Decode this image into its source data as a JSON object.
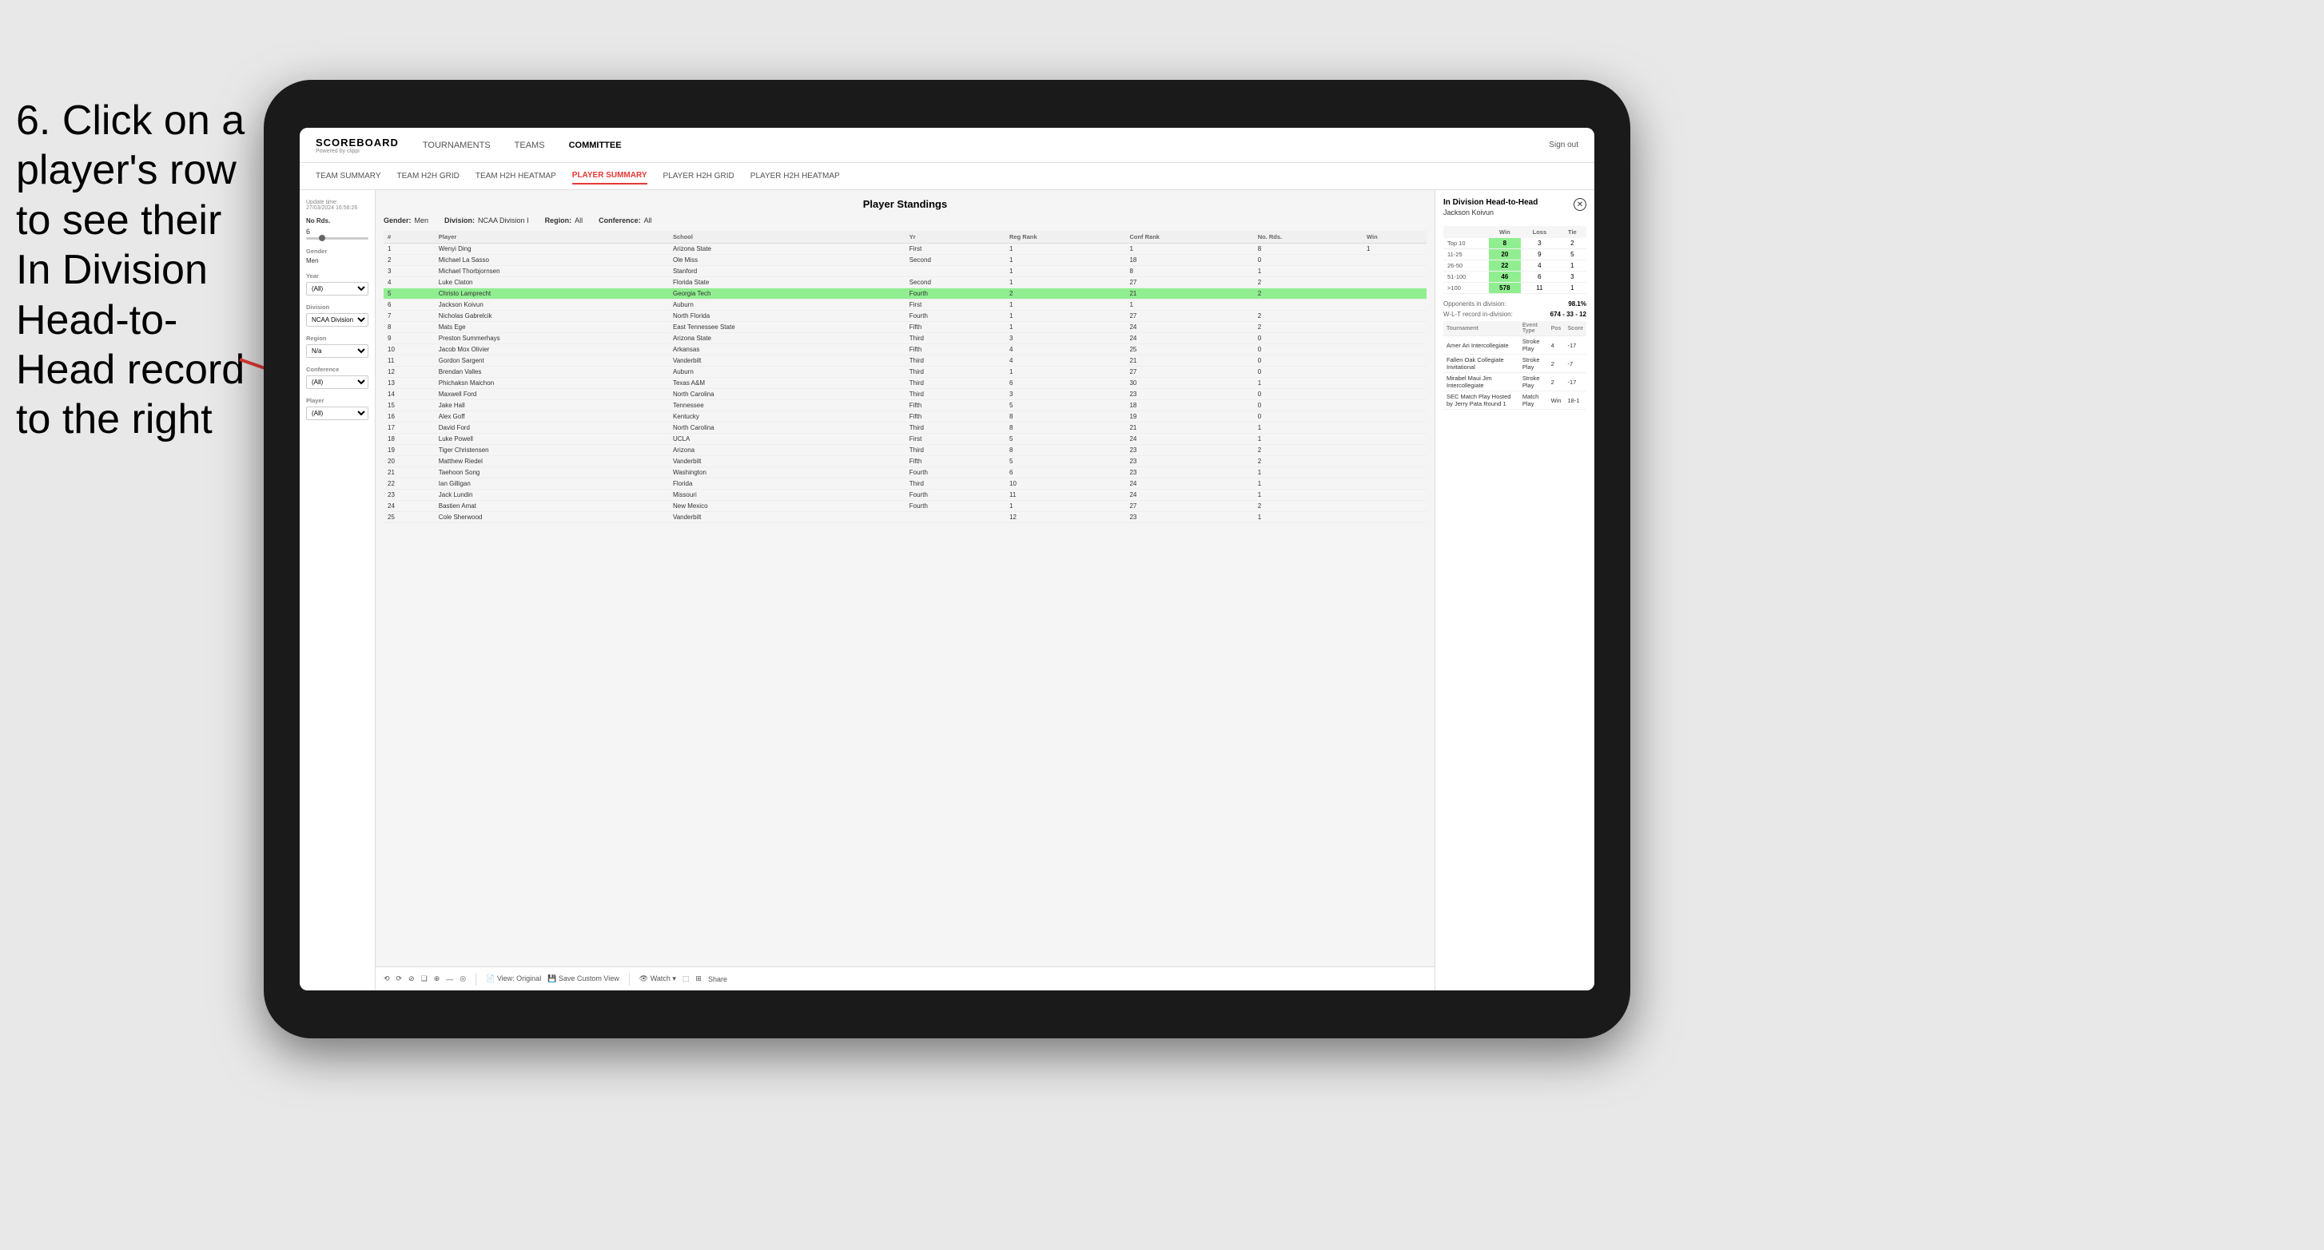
{
  "instruction": {
    "title": "6. Click on a player's row to see their In Division Head-to-Head record to the right"
  },
  "nav": {
    "logo_title": "SCOREBOARD",
    "logo_sub": "Powered by clippi",
    "items": [
      "TOURNAMENTS",
      "TEAMS",
      "COMMITTEE"
    ],
    "sign_out": "Sign out"
  },
  "sub_nav": {
    "items": [
      "TEAM SUMMARY",
      "TEAM H2H GRID",
      "TEAM H2H HEATMAP",
      "PLAYER SUMMARY",
      "PLAYER H2H GRID",
      "PLAYER H2H HEATMAP"
    ],
    "active": "PLAYER SUMMARY"
  },
  "sidebar": {
    "update_time_label": "Update time:",
    "update_time_value": "27/03/2024 16:56:26",
    "no_rds_label": "No Rds.",
    "no_rds_value": "6",
    "gender_label": "Gender",
    "gender_value": "Men",
    "year_label": "Year",
    "year_value": "(All)",
    "division_label": "Division",
    "division_value": "NCAA Division I",
    "region_label": "Region",
    "region_value": "N/a",
    "conference_label": "Conference",
    "conference_value": "(All)",
    "player_label": "Player",
    "player_value": "(All)"
  },
  "standings": {
    "title": "Player Standings",
    "filters": {
      "gender_label": "Gender:",
      "gender_value": "Men",
      "division_label": "Division:",
      "division_value": "NCAA Division I",
      "region_label": "Region:",
      "region_value": "All",
      "conference_label": "Conference:",
      "conference_value": "All"
    },
    "columns": [
      "#",
      "Player",
      "School",
      "Yr",
      "Reg Rank",
      "Conf Rank",
      "No. Rds.",
      "Win"
    ],
    "rows": [
      {
        "num": "1",
        "player": "Wenyi Ding",
        "school": "Arizona State",
        "yr": "First",
        "reg": "1",
        "conf": "1",
        "rds": "8",
        "win": "1"
      },
      {
        "num": "2",
        "player": "Michael La Sasso",
        "school": "Ole Miss",
        "yr": "Second",
        "reg": "1",
        "conf": "18",
        "rds": "0",
        "win": ""
      },
      {
        "num": "3",
        "player": "Michael Thorbjornsen",
        "school": "Stanford",
        "yr": "",
        "reg": "1",
        "conf": "8",
        "rds": "1",
        "win": ""
      },
      {
        "num": "4",
        "player": "Luke Claton",
        "school": "Florida State",
        "yr": "Second",
        "reg": "1",
        "conf": "27",
        "rds": "2",
        "win": ""
      },
      {
        "num": "5",
        "player": "Christo Lamprecht",
        "school": "Georgia Tech",
        "yr": "Fourth",
        "reg": "2",
        "conf": "21",
        "rds": "2",
        "win": ""
      },
      {
        "num": "6",
        "player": "Jackson Koivun",
        "school": "Auburn",
        "yr": "First",
        "reg": "1",
        "conf": "1",
        "rds": "",
        "win": ""
      },
      {
        "num": "7",
        "player": "Nicholas Gabrelcik",
        "school": "North Florida",
        "yr": "Fourth",
        "reg": "1",
        "conf": "27",
        "rds": "2",
        "win": ""
      },
      {
        "num": "8",
        "player": "Mats Ege",
        "school": "East Tennessee State",
        "yr": "Fifth",
        "reg": "1",
        "conf": "24",
        "rds": "2",
        "win": ""
      },
      {
        "num": "9",
        "player": "Preston Summerhays",
        "school": "Arizona State",
        "yr": "Third",
        "reg": "3",
        "conf": "24",
        "rds": "0",
        "win": ""
      },
      {
        "num": "10",
        "player": "Jacob Mox Olivier",
        "school": "Arkansas",
        "yr": "Fifth",
        "reg": "4",
        "conf": "25",
        "rds": "0",
        "win": ""
      },
      {
        "num": "11",
        "player": "Gordon Sargent",
        "school": "Vanderbilt",
        "yr": "Third",
        "reg": "4",
        "conf": "21",
        "rds": "0",
        "win": ""
      },
      {
        "num": "12",
        "player": "Brendan Valles",
        "school": "Auburn",
        "yr": "Third",
        "reg": "1",
        "conf": "27",
        "rds": "0",
        "win": ""
      },
      {
        "num": "13",
        "player": "Phichaksn Maichon",
        "school": "Texas A&M",
        "yr": "Third",
        "reg": "6",
        "conf": "30",
        "rds": "1",
        "win": ""
      },
      {
        "num": "14",
        "player": "Maxwell Ford",
        "school": "North Carolina",
        "yr": "Third",
        "reg": "3",
        "conf": "23",
        "rds": "0",
        "win": ""
      },
      {
        "num": "15",
        "player": "Jake Hall",
        "school": "Tennessee",
        "yr": "Fifth",
        "reg": "5",
        "conf": "18",
        "rds": "0",
        "win": ""
      },
      {
        "num": "16",
        "player": "Alex Goff",
        "school": "Kentucky",
        "yr": "Fifth",
        "reg": "8",
        "conf": "19",
        "rds": "0",
        "win": ""
      },
      {
        "num": "17",
        "player": "David Ford",
        "school": "North Carolina",
        "yr": "Third",
        "reg": "8",
        "conf": "21",
        "rds": "1",
        "win": ""
      },
      {
        "num": "18",
        "player": "Luke Powell",
        "school": "UCLA",
        "yr": "First",
        "reg": "5",
        "conf": "24",
        "rds": "1",
        "win": ""
      },
      {
        "num": "19",
        "player": "Tiger Christensen",
        "school": "Arizona",
        "yr": "Third",
        "reg": "8",
        "conf": "23",
        "rds": "2",
        "win": ""
      },
      {
        "num": "20",
        "player": "Matthew Riedel",
        "school": "Vanderbilt",
        "yr": "Fifth",
        "reg": "5",
        "conf": "23",
        "rds": "2",
        "win": ""
      },
      {
        "num": "21",
        "player": "Taehoon Song",
        "school": "Washington",
        "yr": "Fourth",
        "reg": "6",
        "conf": "23",
        "rds": "1",
        "win": ""
      },
      {
        "num": "22",
        "player": "Ian Gilligan",
        "school": "Florida",
        "yr": "Third",
        "reg": "10",
        "conf": "24",
        "rds": "1",
        "win": ""
      },
      {
        "num": "23",
        "player": "Jack Lundin",
        "school": "Missouri",
        "yr": "Fourth",
        "reg": "11",
        "conf": "24",
        "rds": "1",
        "win": ""
      },
      {
        "num": "24",
        "player": "Bastien Amat",
        "school": "New Mexico",
        "yr": "Fourth",
        "reg": "1",
        "conf": "27",
        "rds": "2",
        "win": ""
      },
      {
        "num": "25",
        "player": "Cole Sherwood",
        "school": "Vanderbilt",
        "yr": "",
        "reg": "12",
        "conf": "23",
        "rds": "1",
        "win": ""
      }
    ],
    "highlighted_row": 5
  },
  "h2h_panel": {
    "title": "In Division Head-to-Head",
    "player_name": "Jackson Koivun",
    "table_headers": [
      "",
      "Win",
      "Loss",
      "Tie"
    ],
    "rows": [
      {
        "rank": "Top 10",
        "win": "8",
        "loss": "3",
        "tie": "2"
      },
      {
        "rank": "11-25",
        "win": "20",
        "loss": "9",
        "tie": "5"
      },
      {
        "rank": "26-50",
        "win": "22",
        "loss": "4",
        "tie": "1"
      },
      {
        "rank": "51-100",
        "win": "46",
        "loss": "6",
        "tie": "3"
      },
      {
        "rank": ">100",
        "win": "578",
        "loss": "11",
        "tie": "1"
      }
    ],
    "opponents_label": "Opponents in division:",
    "wlt_label": "W-L-T record in-division:",
    "opponents_value": "98.1%",
    "wlt_value": "674 - 33 - 12",
    "tournament_columns": [
      "Tournament",
      "Event Type",
      "Pos",
      "Score"
    ],
    "tournaments": [
      {
        "name": "Amer Ari Intercollegiate",
        "type": "Stroke Play",
        "pos": "4",
        "score": "-17"
      },
      {
        "name": "Fallen Oak Collegiate Invitational",
        "type": "Stroke Play",
        "pos": "2",
        "score": "-7"
      },
      {
        "name": "Mirabel Maui Jim Intercollegiate",
        "type": "Stroke Play",
        "pos": "2",
        "score": "-17"
      },
      {
        "name": "SEC Match Play Hosted by Jerry Pata Round 1",
        "type": "Match Play",
        "pos": "Win",
        "score": "18-1"
      }
    ]
  },
  "toolbar": {
    "items": [
      "⟲",
      "⟳",
      "⊘",
      "❏",
      "⊕",
      "—",
      "◎",
      "View: Original",
      "Save Custom View",
      "👁 Watch ▾",
      "⬚",
      "⊞",
      "Share"
    ]
  }
}
